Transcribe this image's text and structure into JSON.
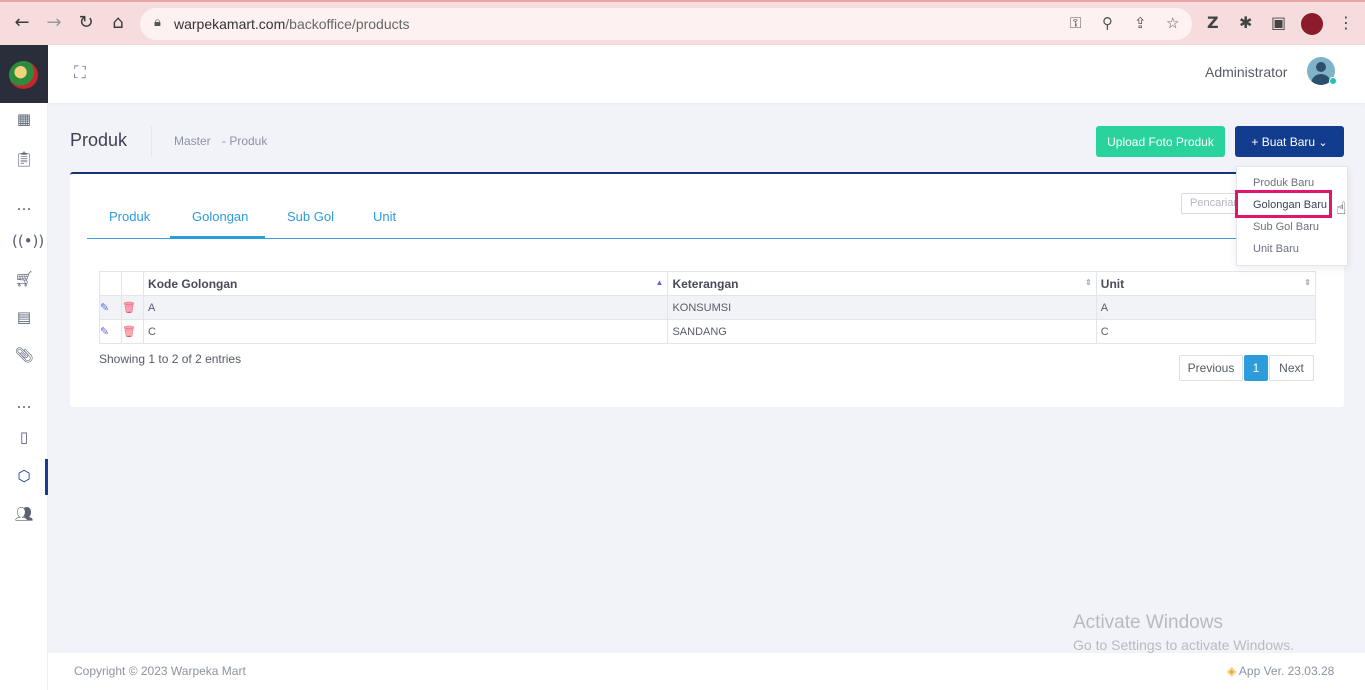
{
  "browser": {
    "url_domain": "warpekamart.com",
    "url_path": "/backoffice/products"
  },
  "header": {
    "user_name": "Administrator"
  },
  "subheader": {
    "title": "Produk",
    "breadcrumb": [
      "Master",
      "- Produk"
    ],
    "upload_label": "Upload Foto Produk",
    "create_label": "+ Buat Baru",
    "create_caret": "⌄"
  },
  "tabs": [
    {
      "label": "Produk",
      "active": false
    },
    {
      "label": "Golongan",
      "active": true
    },
    {
      "label": "Sub Gol",
      "active": false
    },
    {
      "label": "Unit",
      "active": false
    }
  ],
  "search": {
    "placeholder": "Pencarian"
  },
  "table": {
    "headers": [
      "Kode Golongan",
      "Keterangan",
      "Unit"
    ],
    "rows": [
      {
        "kode": "A",
        "keterangan": "KONSUMSI",
        "unit": "A"
      },
      {
        "kode": "C",
        "keterangan": "SANDANG",
        "unit": "C"
      }
    ],
    "info": "Showing 1 to 2 of 2 entries"
  },
  "pagination": {
    "previous": "Previous",
    "current": "1",
    "next": "Next"
  },
  "dropdown": {
    "items": [
      "Produk Baru",
      "Golongan Baru",
      "Sub Gol Baru",
      "Unit Baru"
    ],
    "highlighted": "Golongan Baru"
  },
  "watermark": {
    "line1": "Activate Windows",
    "line2": "Go to Settings to activate Windows."
  },
  "footer": {
    "copyright": "Copyright © 2023 Warpeka Mart",
    "version": "App Ver. 23.03.28"
  },
  "colors": {
    "primary": "#123d8f",
    "success": "#29d39b",
    "info": "#2d9cdb",
    "highlight": "#e0156b"
  }
}
